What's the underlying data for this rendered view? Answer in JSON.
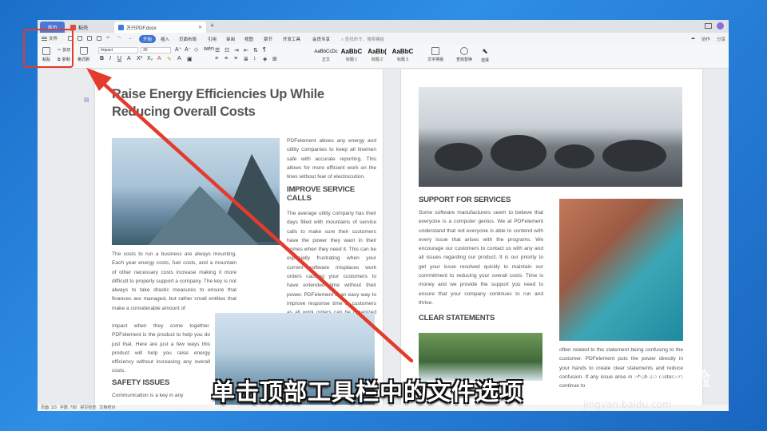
{
  "tabs": {
    "home": "首页",
    "draft": "稻壳",
    "document": "万兴PDF.docx"
  },
  "menu": {
    "file": "文件",
    "start": "开始",
    "items": [
      "插入",
      "页面布局",
      "引用",
      "审阅",
      "视图",
      "章节",
      "开发工具",
      "会员专享"
    ],
    "search": "查找命令、搜索模板",
    "right_items": [
      "协作",
      "分享"
    ]
  },
  "ribbon": {
    "paste": "粘贴",
    "cut": "剪切",
    "copy": "复制",
    "format_painter": "格式刷",
    "font": "Impact",
    "size": "30",
    "styles": [
      {
        "sample": "AaBbCcDc",
        "label": "正文"
      },
      {
        "sample": "AaBbC",
        "label": "标题 1"
      },
      {
        "sample": "AaBb(",
        "label": "标题 2"
      },
      {
        "sample": "AaBbC",
        "label": "标题 3"
      }
    ],
    "text_layout": "文字排版",
    "find_replace": "查找替换",
    "select": "选择"
  },
  "doc": {
    "title": "Raise Energy Efficiencies Up While Reducing Overall Costs",
    "col_right_p1": "PDFelement allows any energy and utility companies to keep all linemen safe with accurate reporting. This allows for more efficient work on the lines without fear of electrocution.",
    "h_improve": "IMPROVE SERVICE CALLS",
    "col_right_p2": "The average utility company has their days filled with mountains of service calls to make sure their customers have the power they want in their homes when they need it. This can be especially frustrating when your current software misplaces work orders causing your customers to have extended time without their power. PDFelement is an easy way to improve response time to customers as all work orders can be organized easily for the employees to",
    "col_left_p1": "The costs to run a business are always mounting. Each year energy costs, fuel costs, and a mountain of other necessary costs increase making it more difficult to properly support a company. The key is not always to take drastic measures to ensure that finances are managed, but rather small entities that make a considerable amount of",
    "col_left_p2": "impact when they come together. PDFelement is the product to help you do just that. Here are just a few ways this product will help you raise energy efficiency without increasing any overall costs.",
    "h_safety": "SAFETY ISSUES",
    "col_left_p3": "Communication is a key in any",
    "h_support": "SUPPORT FOR SERVICES",
    "p2_p1": "Some software manufacturers seem to believe that everyone is a computer genius. We at PDFelement understand that not everyone is able to contend with every issue that arises with the programs. We encourage our customers to contact us with any and all issues regarding our product. It is our priority to get your issue resolved quickly to maintain our commitment to reducing your overall costs. Time is money and we provide the support you need to ensure that your company continues to run and thrive.",
    "h_clear": "CLEAR STATEMENTS",
    "p2_p2": "often related to the statement being confusing to the customer. PDFelement puts the power directly in your hands to create clear statements and reduce confusion. If any issue arise in which the customers continue to"
  },
  "status": {
    "page": "页面: 1/3",
    "words": "字数: 798",
    "spell": "拼写检查",
    "proof": "文档校对"
  },
  "caption": "单击顶部工具栏中的文件选项",
  "watermark": {
    "main": "Bai 经验",
    "sub": "jingyan.baidu.com"
  },
  "colors": {
    "highlight": "#e33b2c",
    "accent": "#3f73d6"
  }
}
